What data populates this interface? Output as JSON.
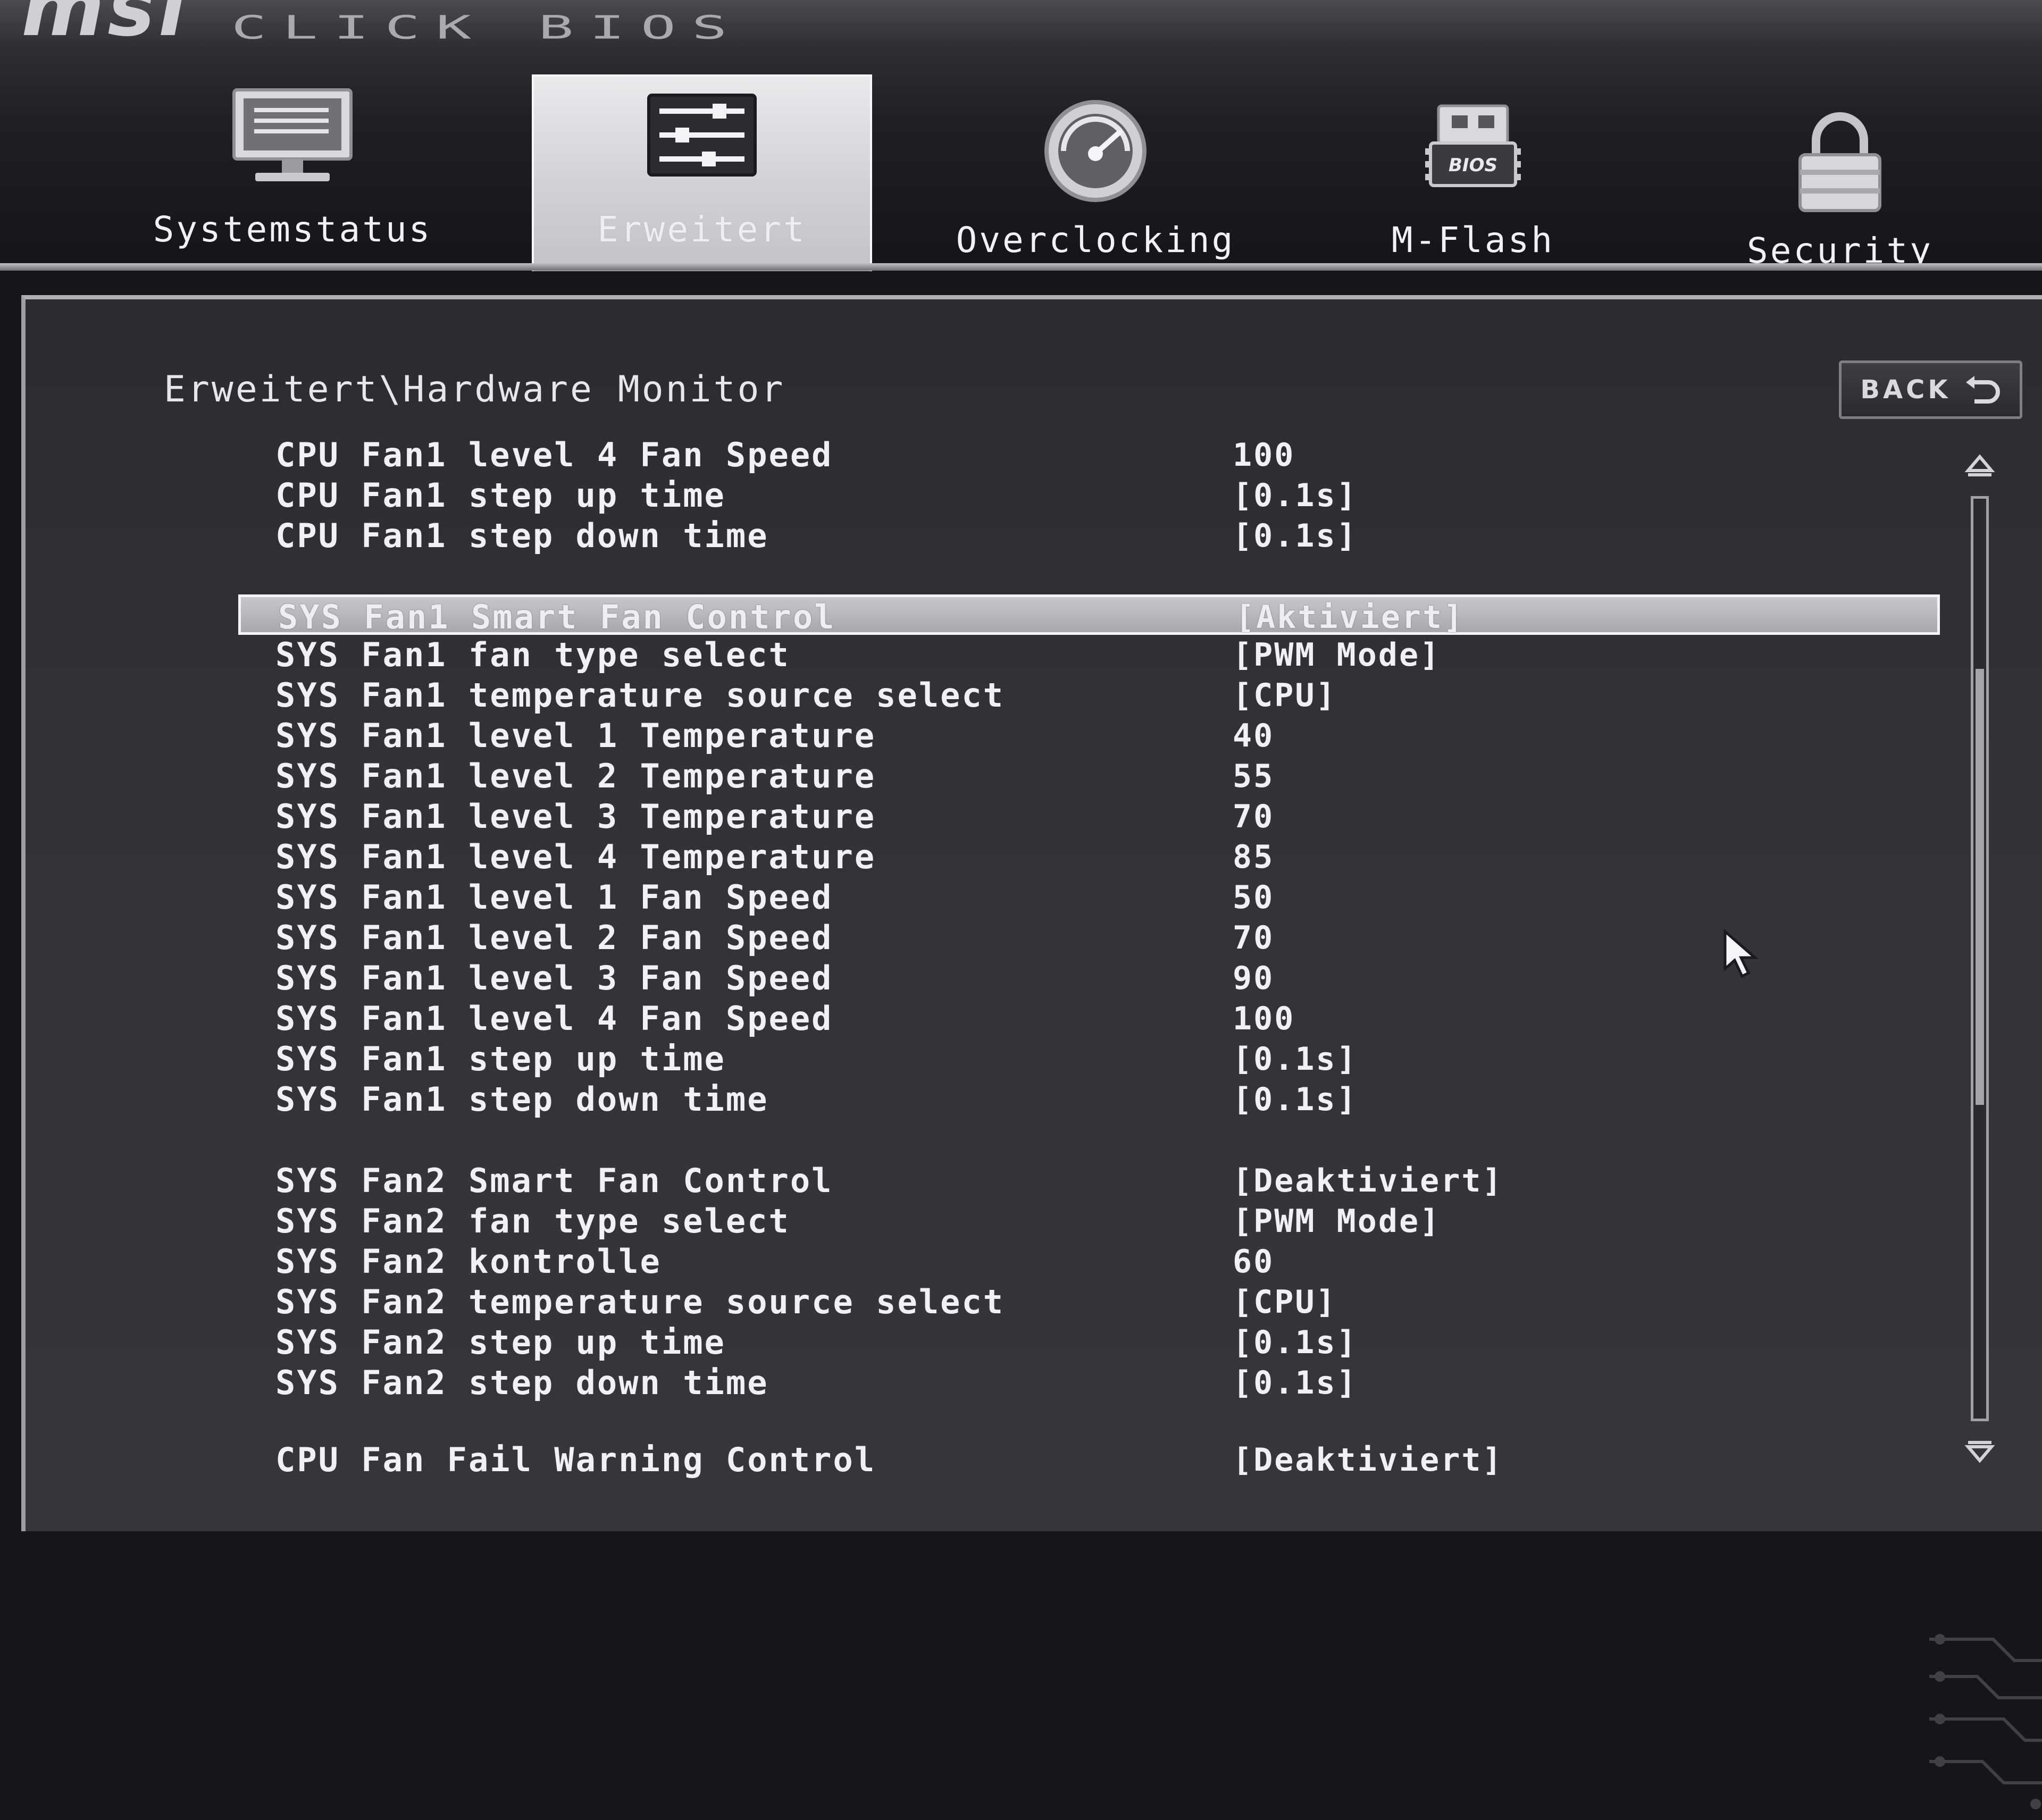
{
  "header": {
    "brand": "msi",
    "product": "CLICK BIOS",
    "tabs": [
      {
        "label": "Systemstatus",
        "icon": "monitor-icon",
        "active": false
      },
      {
        "label": "Erweitert",
        "icon": "settings-panel-icon",
        "active": true
      },
      {
        "label": "Overclocking",
        "icon": "speedometer-icon",
        "active": false
      },
      {
        "label": "M-Flash",
        "icon": "bios-chip-icon",
        "active": false
      },
      {
        "label": "Security",
        "icon": "padlock-icon",
        "active": false
      }
    ]
  },
  "panel": {
    "breadcrumb": "Erweitert\\Hardware Monitor",
    "back_label": "BACK",
    "settings": [
      {
        "label": "CPU Fan1 level 4 Fan Speed",
        "value": "100"
      },
      {
        "label": "CPU Fan1 step up time",
        "value": "[0.1s]"
      },
      {
        "label": "CPU Fan1 step down time",
        "value": "[0.1s]"
      },
      {
        "label": "SYS Fan1 Smart Fan Control",
        "value": "[Aktiviert]",
        "selected": true
      },
      {
        "label": "SYS Fan1 fan type select",
        "value": "[PWM Mode]"
      },
      {
        "label": "SYS Fan1 temperature source select",
        "value": "[CPU]"
      },
      {
        "label": "SYS Fan1 level 1 Temperature",
        "value": "40"
      },
      {
        "label": "SYS Fan1 level 2 Temperature",
        "value": "55"
      },
      {
        "label": "SYS Fan1 level 3 Temperature",
        "value": "70"
      },
      {
        "label": "SYS Fan1 level 4 Temperature",
        "value": "85"
      },
      {
        "label": "SYS Fan1 level 1 Fan Speed",
        "value": "50"
      },
      {
        "label": "SYS Fan1 level 2 Fan Speed",
        "value": "70"
      },
      {
        "label": "SYS Fan1 level 3 Fan Speed",
        "value": "90"
      },
      {
        "label": "SYS Fan1 level 4 Fan Speed",
        "value": "100"
      },
      {
        "label": "SYS Fan1 step up time",
        "value": "[0.1s]"
      },
      {
        "label": "SYS Fan1 step down time",
        "value": "[0.1s]"
      },
      {
        "label": "SYS Fan2 Smart Fan Control",
        "value": "[Deaktiviert]"
      },
      {
        "label": "SYS Fan2 fan type select",
        "value": "[PWM Mode]"
      },
      {
        "label": "SYS Fan2 kontrolle",
        "value": "60"
      },
      {
        "label": "SYS Fan2 temperature source select",
        "value": "[CPU]"
      },
      {
        "label": "SYS Fan2 step up time",
        "value": "[0.1s]"
      },
      {
        "label": "SYS Fan2 step down time",
        "value": "[0.1s]"
      },
      {
        "label": "CPU Fan Fail Warning Control",
        "value": "[Deaktiviert]"
      }
    ]
  },
  "colors": {
    "background": "#151619",
    "panel": "#323338",
    "text": "#f0f1f3",
    "selection": "#b7b8bb",
    "active_tab": "#d3d4d7"
  }
}
